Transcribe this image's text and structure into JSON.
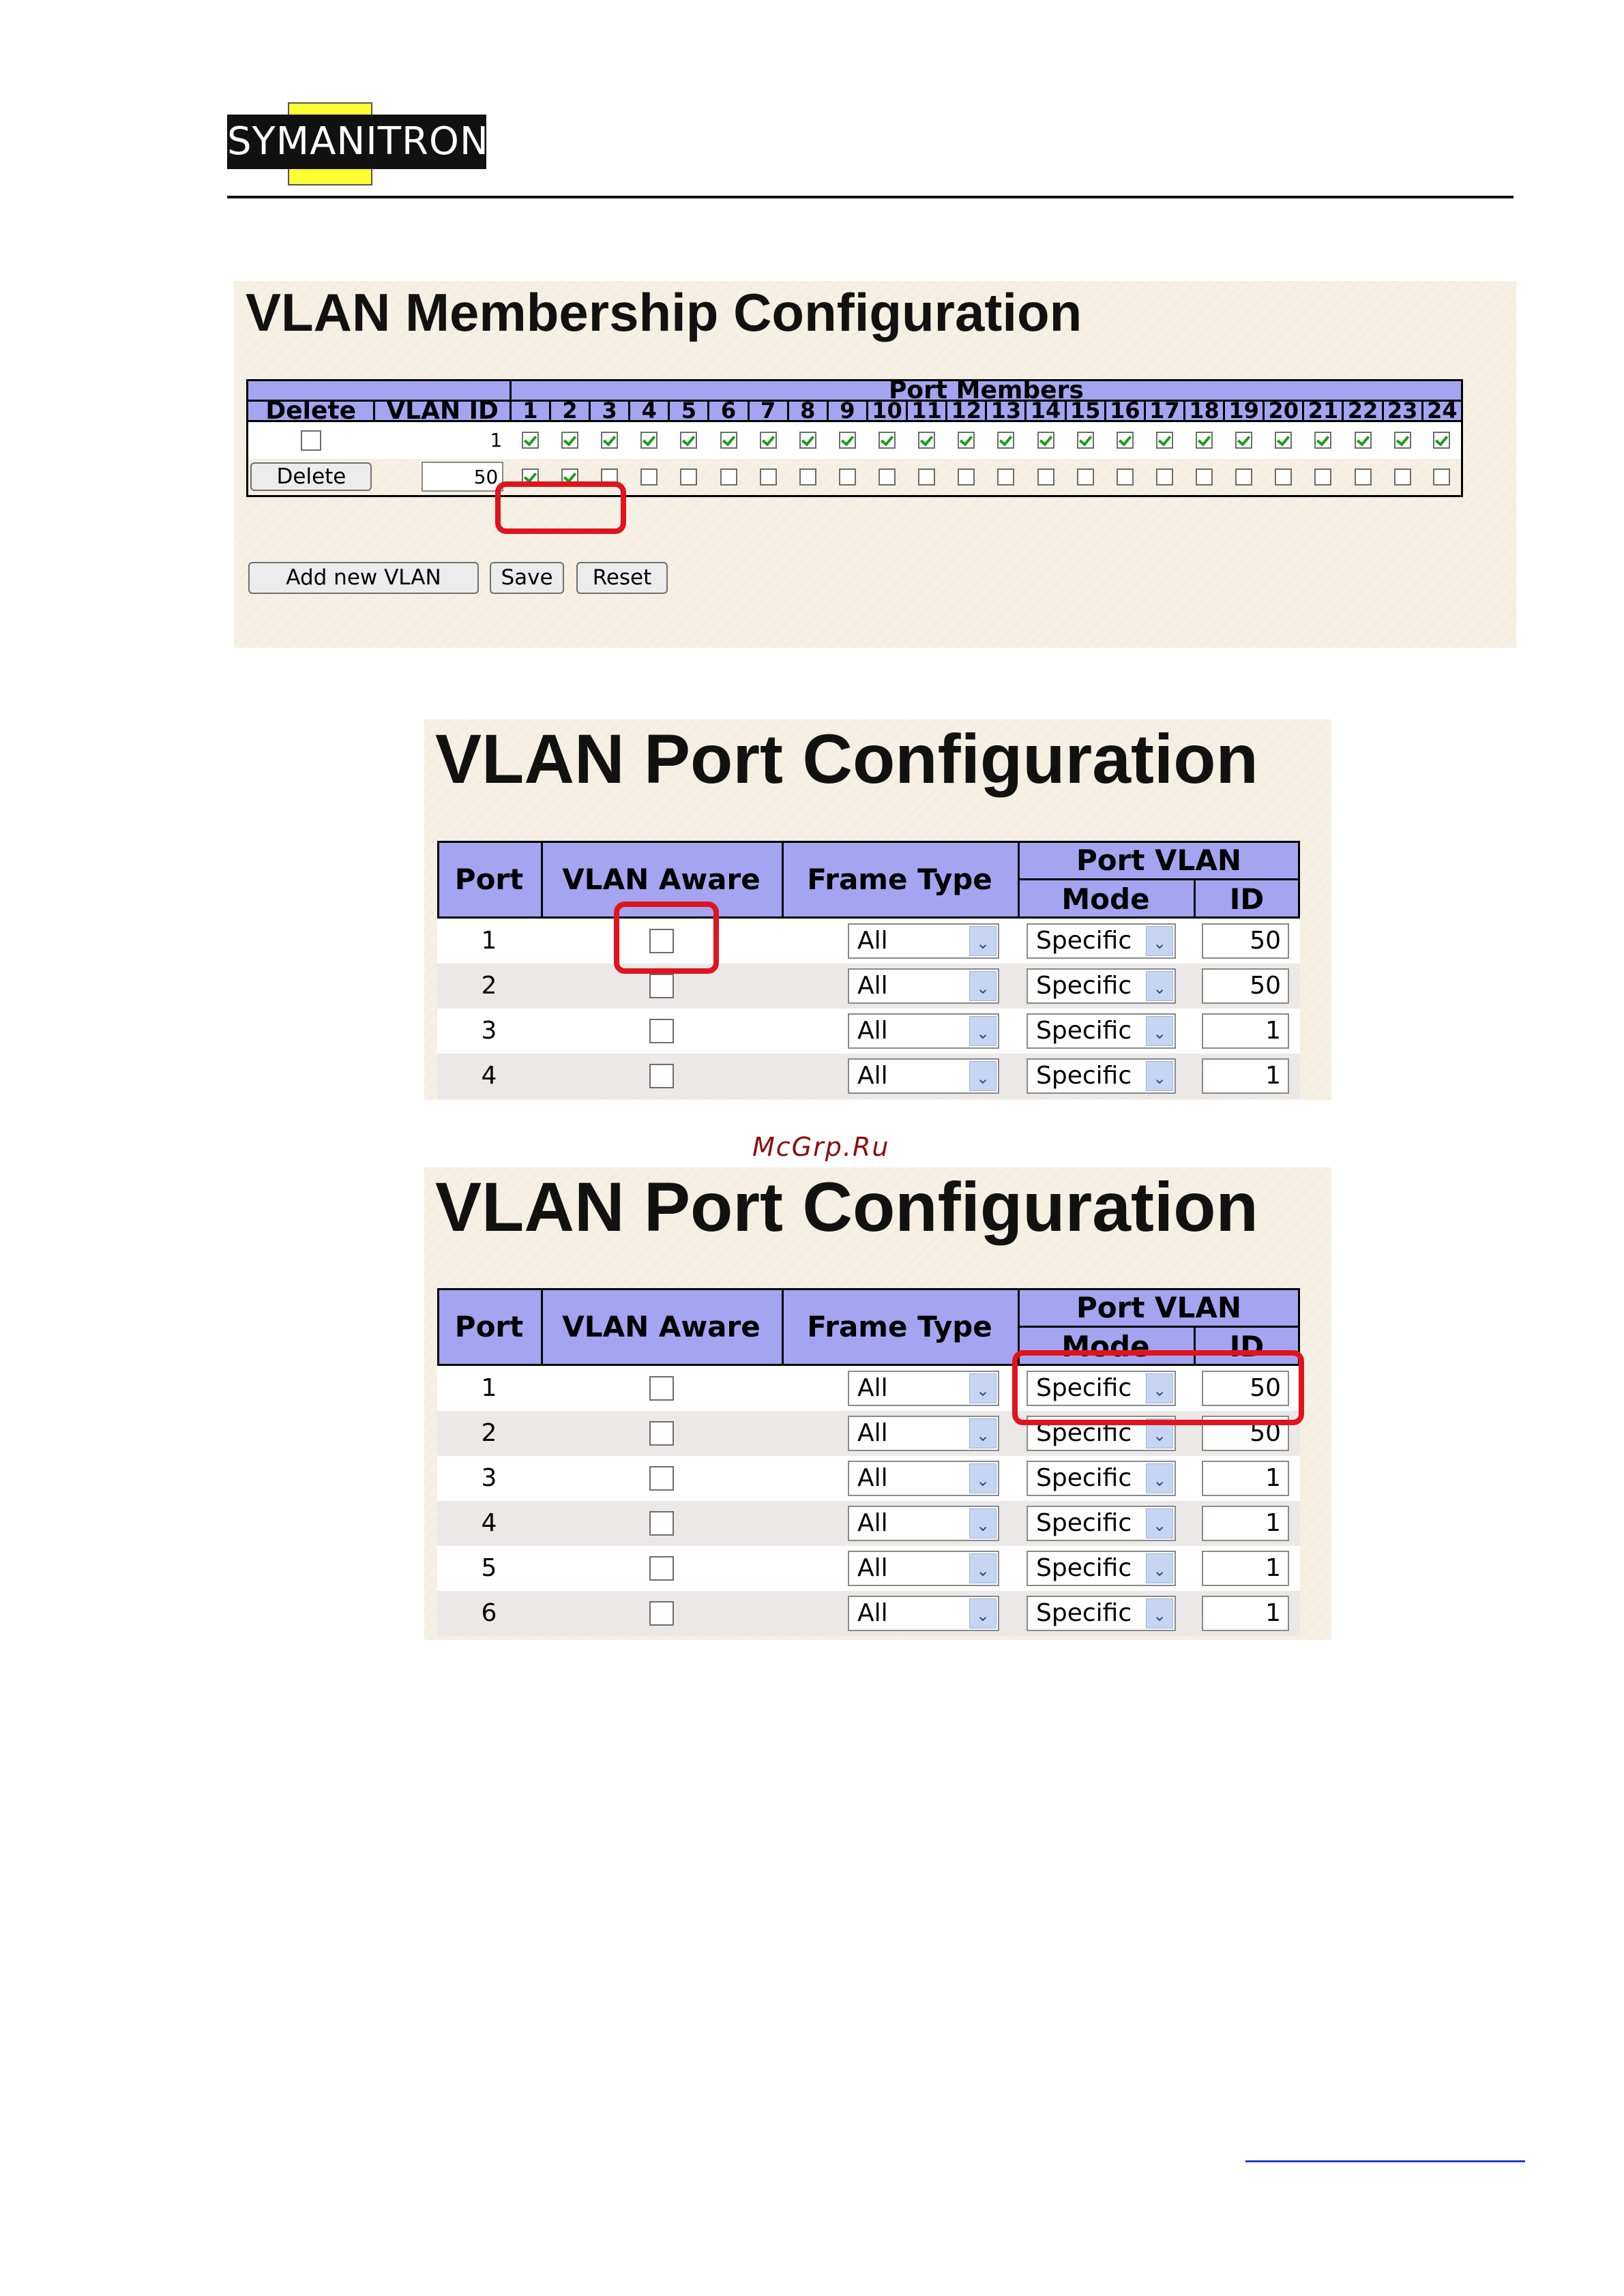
{
  "logo": {
    "text": "SYMANITRON"
  },
  "watermark": "McGrp.Ru",
  "membership": {
    "title": "VLAN Membership Configuration",
    "headers": {
      "delete": "Delete",
      "vlan_id": "VLAN ID",
      "port_members": "Port Members"
    },
    "ports": [
      "1",
      "2",
      "3",
      "4",
      "5",
      "6",
      "7",
      "8",
      "9",
      "10",
      "11",
      "12",
      "13",
      "14",
      "15",
      "16",
      "17",
      "18",
      "19",
      "20",
      "21",
      "22",
      "23",
      "24"
    ],
    "rows": [
      {
        "vlan_id": "1",
        "delete_type": "checkbox",
        "members": [
          true,
          true,
          true,
          true,
          true,
          true,
          true,
          true,
          true,
          true,
          true,
          true,
          true,
          true,
          true,
          true,
          true,
          true,
          true,
          true,
          true,
          true,
          true,
          true
        ]
      },
      {
        "vlan_id": "50",
        "delete_type": "button",
        "delete_label": "Delete",
        "members": [
          true,
          true,
          false,
          false,
          false,
          false,
          false,
          false,
          false,
          false,
          false,
          false,
          false,
          false,
          false,
          false,
          false,
          false,
          false,
          false,
          false,
          false,
          false,
          false
        ]
      }
    ],
    "buttons": {
      "add": "Add new VLAN",
      "save": "Save",
      "reset": "Reset"
    }
  },
  "port_config_1": {
    "title": "VLAN Port Configuration",
    "headers": {
      "port": "Port",
      "vlan_aware": "VLAN Aware",
      "frame_type": "Frame Type",
      "port_vlan": "Port VLAN",
      "mode": "Mode",
      "id": "ID"
    },
    "rows": [
      {
        "port": "1",
        "aware": false,
        "frame": "All",
        "mode": "Specific",
        "id": "50"
      },
      {
        "port": "2",
        "aware": false,
        "frame": "All",
        "mode": "Specific",
        "id": "50"
      },
      {
        "port": "3",
        "aware": false,
        "frame": "All",
        "mode": "Specific",
        "id": "1"
      },
      {
        "port": "4",
        "aware": false,
        "frame": "All",
        "mode": "Specific",
        "id": "1"
      }
    ]
  },
  "port_config_2": {
    "title": "VLAN Port Configuration",
    "headers": {
      "port": "Port",
      "vlan_aware": "VLAN Aware",
      "frame_type": "Frame Type",
      "port_vlan": "Port VLAN",
      "mode": "Mode",
      "id": "ID"
    },
    "rows": [
      {
        "port": "1",
        "aware": false,
        "frame": "All",
        "mode": "Specific",
        "id": "50"
      },
      {
        "port": "2",
        "aware": false,
        "frame": "All",
        "mode": "Specific",
        "id": "50"
      },
      {
        "port": "3",
        "aware": false,
        "frame": "All",
        "mode": "Specific",
        "id": "1"
      },
      {
        "port": "4",
        "aware": false,
        "frame": "All",
        "mode": "Specific",
        "id": "1"
      },
      {
        "port": "5",
        "aware": false,
        "frame": "All",
        "mode": "Specific",
        "id": "1"
      },
      {
        "port": "6",
        "aware": false,
        "frame": "All",
        "mode": "Specific",
        "id": "1"
      }
    ]
  },
  "colors": {
    "header_bg": "#a5a4f1",
    "panel_bg": "#f6f1e4",
    "highlight": "#e0131e",
    "check": "#1b9c1b"
  }
}
